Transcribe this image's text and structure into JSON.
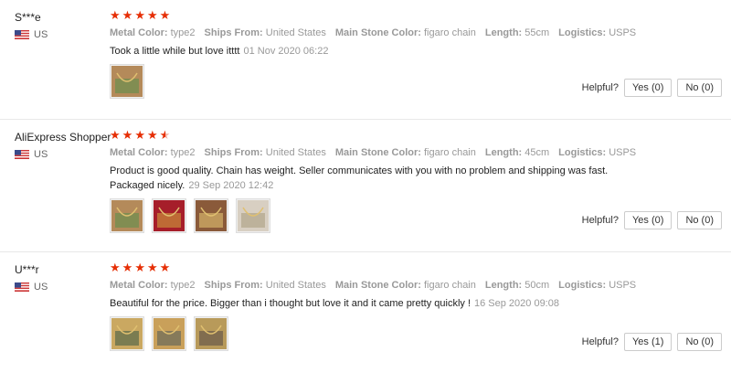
{
  "reviews": [
    {
      "username": "S***e",
      "country": "US",
      "rating": 5,
      "attrs": [
        {
          "label": "Metal Color:",
          "value": "type2"
        },
        {
          "label": "Ships From:",
          "value": "United States"
        },
        {
          "label": "Main Stone Color:",
          "value": "figaro chain"
        },
        {
          "label": "Length:",
          "value": "55cm"
        },
        {
          "label": "Logistics:",
          "value": "USPS"
        }
      ],
      "text": "Took a little while but love itttt",
      "date": "01 Nov 2020 06:22",
      "photos": [
        "photo-1"
      ],
      "helpful_label": "Helpful?",
      "yes": "Yes (0)",
      "no": "No (0)"
    },
    {
      "username": "AliExpress Shopper",
      "country": "US",
      "rating": 4.5,
      "attrs": [
        {
          "label": "Metal Color:",
          "value": "type2"
        },
        {
          "label": "Ships From:",
          "value": "United States"
        },
        {
          "label": "Main Stone Color:",
          "value": "figaro chain"
        },
        {
          "label": "Length:",
          "value": "45cm"
        },
        {
          "label": "Logistics:",
          "value": "USPS"
        }
      ],
      "text": "Product is good quality. Chain has weight. Seller communicates with you with no problem and shipping was fast. Packaged nicely.",
      "date": "29 Sep 2020 12:42",
      "photos": [
        "photo-1",
        "photo-2",
        "photo-3",
        "photo-4"
      ],
      "helpful_label": "Helpful?",
      "yes": "Yes (0)",
      "no": "No (0)"
    },
    {
      "username": "U***r",
      "country": "US",
      "rating": 5,
      "attrs": [
        {
          "label": "Metal Color:",
          "value": "type2"
        },
        {
          "label": "Ships From:",
          "value": "United States"
        },
        {
          "label": "Main Stone Color:",
          "value": "figaro chain"
        },
        {
          "label": "Length:",
          "value": "50cm"
        },
        {
          "label": "Logistics:",
          "value": "USPS"
        }
      ],
      "text": "Beautiful for the price. Bigger than i thought but love it and it came pretty quickly !",
      "date": "16 Sep 2020 09:08",
      "photos": [
        "photo-1",
        "photo-2",
        "photo-3"
      ],
      "helpful_label": "Helpful?",
      "yes": "Yes (1)",
      "no": "No (0)"
    }
  ],
  "colors": {
    "star": "#e62e04",
    "text": "#222222",
    "muted": "#999999"
  }
}
